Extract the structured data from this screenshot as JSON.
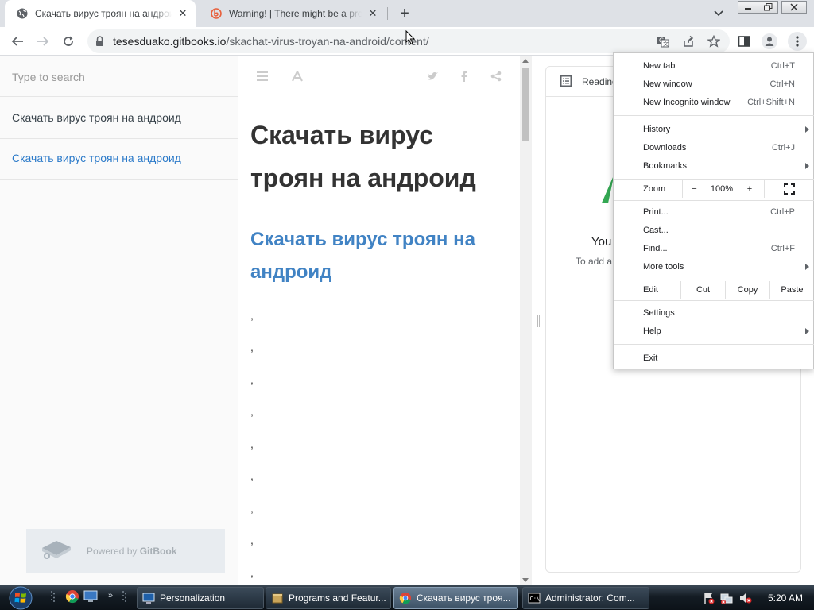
{
  "browser": {
    "tabs": [
      {
        "title": "Скачать вирус троян на андроид - GitBook",
        "close": "✕"
      },
      {
        "title": "Warning! | There might be a problem",
        "close": "✕"
      }
    ],
    "new_tab_glyph": "+",
    "url_host": "tesesduako.gitbooks.io",
    "url_path": "/skachat-virus-troyan-na-android/content/"
  },
  "gitbook": {
    "search_placeholder": "Type to search",
    "nav_items": [
      "Скачать вирус троян на андроид",
      "Скачать вирус троян на андроид"
    ],
    "powered_prefix": "Powered by ",
    "powered_brand": "GitBook",
    "title": "Скачать вирус троян на андроид",
    "subtitle": "Скачать вирус троян на андроид",
    "commas": [
      ",",
      ",",
      ",",
      ",",
      ",",
      ",",
      ",",
      ",",
      ","
    ]
  },
  "side_panel": {
    "header": "Reading",
    "title": "You",
    "subtitle": "To add a"
  },
  "menu": {
    "new_tab": {
      "label": "New tab",
      "shortcut": "Ctrl+T"
    },
    "new_window": {
      "label": "New window",
      "shortcut": "Ctrl+N"
    },
    "incognito": {
      "label": "New Incognito window",
      "shortcut": "Ctrl+Shift+N"
    },
    "history": {
      "label": "History"
    },
    "downloads": {
      "label": "Downloads",
      "shortcut": "Ctrl+J"
    },
    "bookmarks": {
      "label": "Bookmarks"
    },
    "zoom": {
      "label": "Zoom",
      "minus": "−",
      "value": "100%",
      "plus": "+"
    },
    "print": {
      "label": "Print...",
      "shortcut": "Ctrl+P"
    },
    "cast": {
      "label": "Cast..."
    },
    "find": {
      "label": "Find...",
      "shortcut": "Ctrl+F"
    },
    "more_tools": {
      "label": "More tools"
    },
    "edit": {
      "label": "Edit",
      "cut": "Cut",
      "copy": "Copy",
      "paste": "Paste"
    },
    "settings": {
      "label": "Settings"
    },
    "help": {
      "label": "Help"
    },
    "exit": {
      "label": "Exit"
    }
  },
  "taskbar": {
    "tasks": [
      "Personalization",
      "Programs and Featur...",
      "Скачать вирус троя...",
      "Administrator:  Com..."
    ],
    "clock": "5:20 AM"
  },
  "colors": {
    "link": "#2b7ac9",
    "heading_link": "#4183c4",
    "menu_bg": "#ffffff"
  }
}
